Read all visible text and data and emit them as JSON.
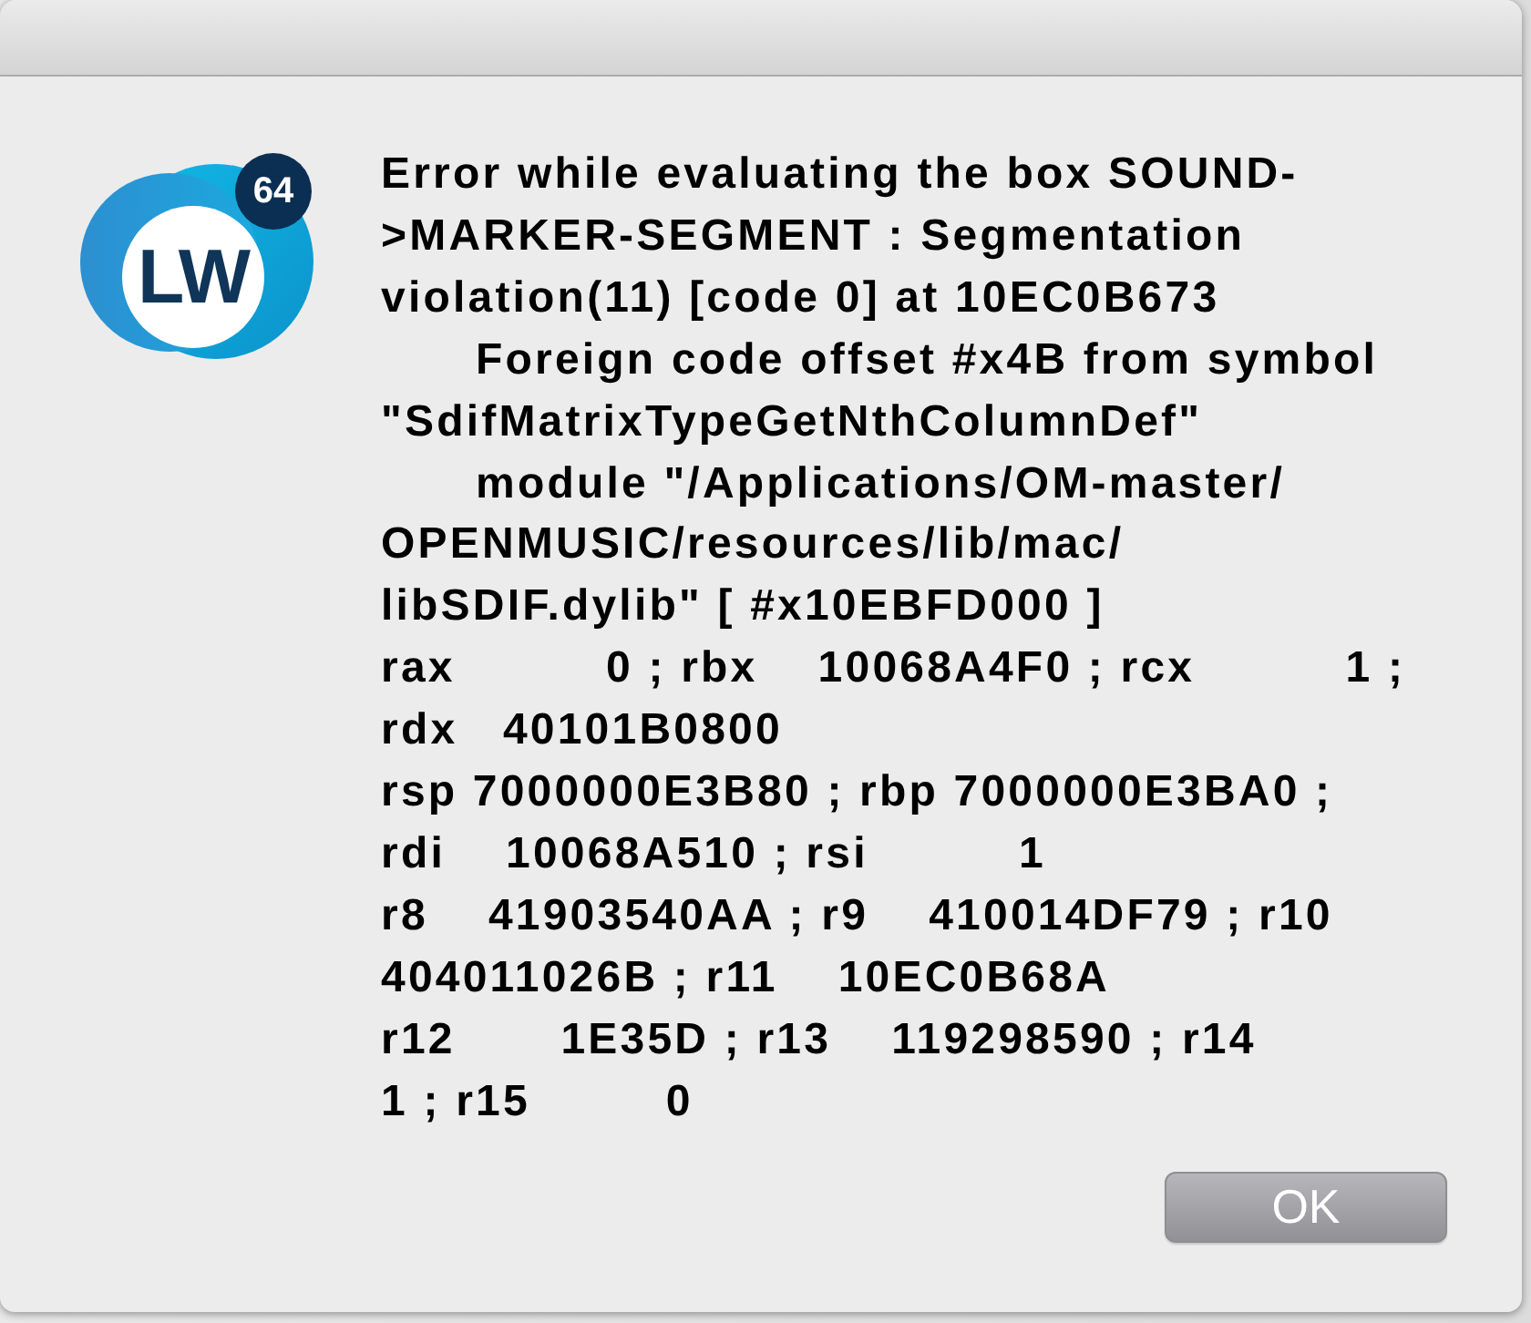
{
  "dialog": {
    "icon": {
      "logo_text": "LW",
      "badge": "64"
    },
    "message": [
      {
        "text": "Error while evaluating the box SOUND-",
        "indented": false
      },
      {
        "text": ">MARKER-SEGMENT : Segmentation",
        "indented": false
      },
      {
        "text": "violation(11) [code 0] at 10EC0B673",
        "indented": false
      },
      {
        "text": "Foreign code offset #x4B from symbol",
        "indented": true
      },
      {
        "text": "\"SdifMatrixTypeGetNthColumnDef\"",
        "indented": false
      },
      {
        "text": "module \"/Applications/OM-master/",
        "indented": true
      },
      {
        "text": "OPENMUSIC/resources/lib/mac/",
        "indented": false
      },
      {
        "text": "libSDIF.dylib\" [ #x10EBFD000 ]",
        "indented": false
      },
      {
        "text": "rax          0 ; rbx    10068A4F0 ; rcx          1 ;",
        "indented": false
      },
      {
        "text": "rdx   40101B0800",
        "indented": false
      },
      {
        "text": "rsp 7000000E3B80 ; rbp 7000000E3BA0 ;",
        "indented": false
      },
      {
        "text": "rdi    10068A510 ; rsi          1",
        "indented": false
      },
      {
        "text": "r8    41903540AA ; r9    410014DF79 ; r10",
        "indented": false
      },
      {
        "text": "404011026B ; r11    10EC0B68A",
        "indented": false
      },
      {
        "text": "r12       1E35D ; r13    119298590 ; r14",
        "indented": false
      },
      {
        "text": "1 ; r15         0",
        "indented": false
      }
    ],
    "buttons": [
      {
        "label": "OK"
      }
    ]
  }
}
